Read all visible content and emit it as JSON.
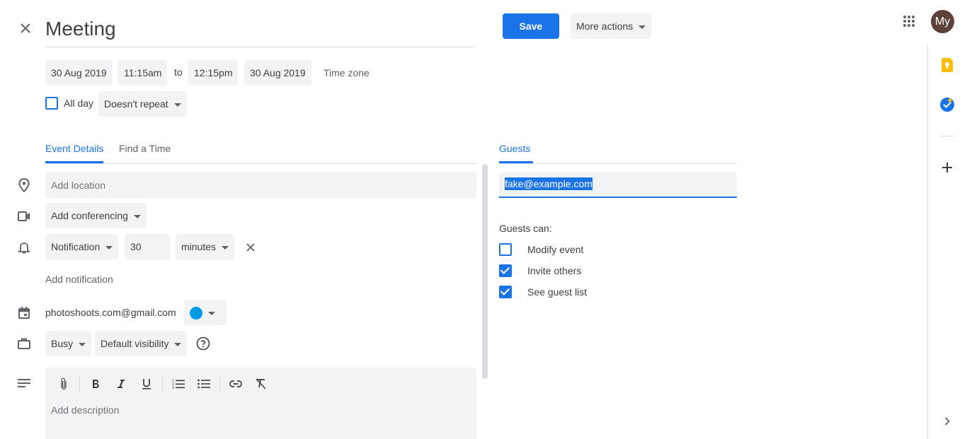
{
  "header": {
    "title": "Meeting",
    "save_label": "Save",
    "more_actions_label": "More actions",
    "avatar_text": "My",
    "colors": {
      "primary": "#1a73e8",
      "avatar_bg": "#5d4037"
    }
  },
  "datetime": {
    "start_date": "30 Aug 2019",
    "start_time": "11:15am",
    "to_label": "to",
    "end_time": "12:15pm",
    "end_date": "30 Aug 2019",
    "timezone_label": "Time zone",
    "all_day_label": "All day",
    "all_day_checked": false,
    "repeat_label": "Doesn't repeat"
  },
  "tabs": {
    "event_details": "Event Details",
    "find_a_time": "Find a Time",
    "guests": "Guests"
  },
  "details": {
    "location_placeholder": "Add location",
    "conferencing_label": "Add conferencing",
    "notification_type": "Notification",
    "notification_value": "30",
    "notification_unit": "minutes",
    "add_notification_label": "Add notification",
    "calendar_owner": "photoshoots.com@gmail.com",
    "calendar_color": "#039be5",
    "availability_label": "Busy",
    "visibility_label": "Default visibility",
    "description_placeholder": "Add description"
  },
  "guests": {
    "input_value": "fake@example.com",
    "permissions_heading": "Guests can:",
    "permissions": [
      {
        "label": "Modify event",
        "checked": false
      },
      {
        "label": "Invite others",
        "checked": true
      },
      {
        "label": "See guest list",
        "checked": true
      }
    ]
  },
  "side_panel": {
    "icons": [
      "keep-icon",
      "tasks-icon",
      "add-icon",
      "chevron-right-icon"
    ],
    "colors": {
      "keep": "#fbbc04",
      "tasks": "#1a73e8"
    }
  }
}
